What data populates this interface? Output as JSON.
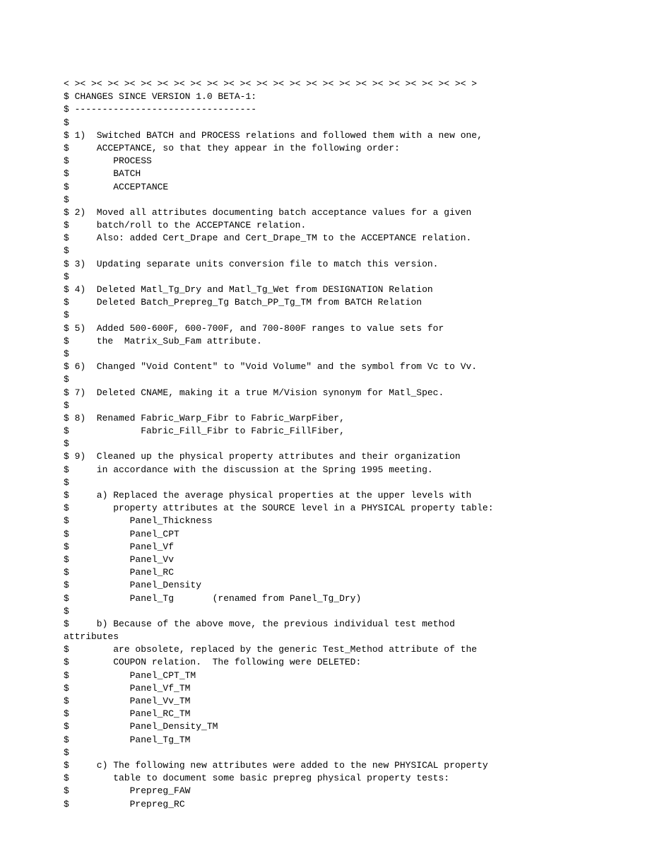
{
  "lines": [
    "< >< >< >< >< >< >< >< >< >< >< >< >< >< >< >< >< >< >< >< >< >< >< >< >< >",
    "$ CHANGES SINCE VERSION 1.0 BETA-1:",
    "$ ---------------------------------",
    "$",
    "$ 1)  Switched BATCH and PROCESS relations and followed them with a new one,",
    "$     ACCEPTANCE, so that they appear in the following order:",
    "$        PROCESS",
    "$        BATCH",
    "$        ACCEPTANCE",
    "$",
    "$ 2)  Moved all attributes documenting batch acceptance values for a given",
    "$     batch/roll to the ACCEPTANCE relation.",
    "$     Also: added Cert_Drape and Cert_Drape_TM to the ACCEPTANCE relation.",
    "$",
    "$ 3)  Updating separate units conversion file to match this version.",
    "$",
    "$ 4)  Deleted Matl_Tg_Dry and Matl_Tg_Wet from DESIGNATION Relation",
    "$     Deleted Batch_Prepreg_Tg Batch_PP_Tg_TM from BATCH Relation",
    "$",
    "$ 5)  Added 500-600F, 600-700F, and 700-800F ranges to value sets for",
    "$     the  Matrix_Sub_Fam attribute.",
    "$",
    "$ 6)  Changed \"Void Content\" to \"Void Volume\" and the symbol from Vc to Vv.",
    "$",
    "$ 7)  Deleted CNAME, making it a true M/Vision synonym for Matl_Spec.",
    "$",
    "$ 8)  Renamed Fabric_Warp_Fibr to Fabric_WarpFiber,",
    "$             Fabric_Fill_Fibr to Fabric_FillFiber,",
    "$",
    "$ 9)  Cleaned up the physical property attributes and their organization",
    "$     in accordance with the discussion at the Spring 1995 meeting.",
    "$",
    "$     a) Replaced the average physical properties at the upper levels with",
    "$        property attributes at the SOURCE level in a PHYSICAL property table:",
    "$           Panel_Thickness",
    "$           Panel_CPT",
    "$           Panel_Vf",
    "$           Panel_Vv",
    "$           Panel_RC",
    "$           Panel_Density",
    "$           Panel_Tg       (renamed from Panel_Tg_Dry)",
    "$",
    "$     b) Because of the above move, the previous individual test method",
    "attributes",
    "$        are obsolete, replaced by the generic Test_Method attribute of the",
    "$        COUPON relation.  The following were DELETED:",
    "$           Panel_CPT_TM",
    "$           Panel_Vf_TM",
    "$           Panel_Vv_TM",
    "$           Panel_RC_TM",
    "$           Panel_Density_TM",
    "$           Panel_Tg_TM",
    "$",
    "$     c) The following new attributes were added to the new PHYSICAL property",
    "$        table to document some basic prepreg physical property tests:",
    "$           Prepreg_FAW",
    "$           Prepreg_RC"
  ]
}
